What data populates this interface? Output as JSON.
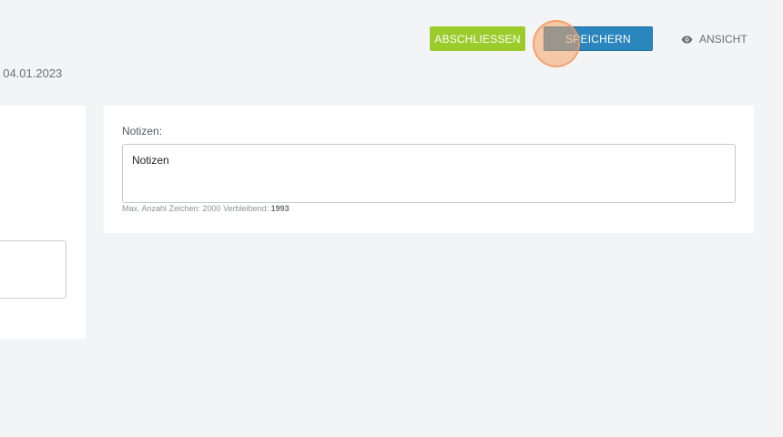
{
  "toolbar": {
    "finish_label": "ABSCHLIESSEN",
    "save_label": "SPEICHERN",
    "view_label": "ANSICHT",
    "view_icon": "eye-icon",
    "finish_color": "#9ccc2c",
    "save_color": "#2a86bd"
  },
  "header": {
    "date_text": ", 04.01.2023"
  },
  "notes": {
    "label": "Notizen:",
    "value": "Notizen",
    "hint_prefix": "Max. Anzahl Zeichen: 2000 Verbleibend:",
    "remaining": "1993"
  }
}
